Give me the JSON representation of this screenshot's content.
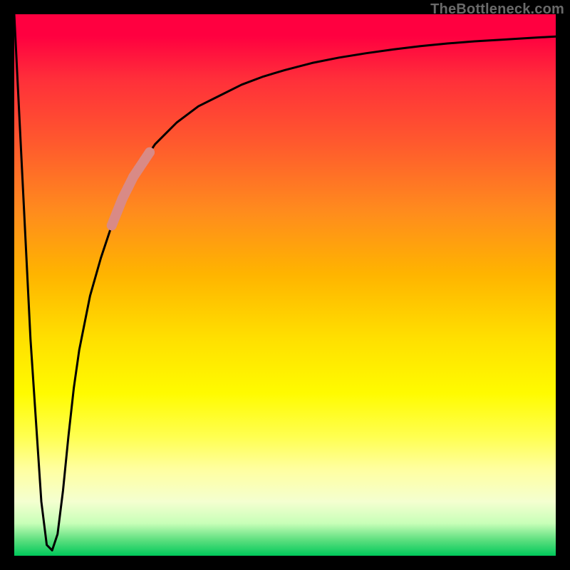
{
  "watermark": "TheBottleneck.com",
  "chart_data": {
    "type": "line",
    "title": "",
    "xlabel": "",
    "ylabel": "",
    "xlim": [
      0,
      100
    ],
    "ylim": [
      0,
      100
    ],
    "grid": false,
    "legend": false,
    "series": [
      {
        "name": "bottleneck-curve",
        "color": "#000000",
        "x": [
          0,
          1,
          3,
          5,
          6,
          7,
          8,
          9,
          10,
          11,
          12,
          14,
          16,
          18,
          20,
          22,
          24,
          26,
          28,
          30,
          34,
          38,
          42,
          46,
          50,
          55,
          60,
          65,
          70,
          75,
          80,
          85,
          90,
          95,
          100
        ],
        "values": [
          100,
          80,
          40,
          10,
          2,
          1,
          4,
          12,
          22,
          31,
          38,
          48,
          55,
          61,
          66,
          70,
          73,
          76,
          78,
          80,
          83,
          85,
          87,
          88.5,
          89.7,
          91,
          92,
          92.8,
          93.5,
          94.1,
          94.6,
          95,
          95.3,
          95.6,
          95.9
        ]
      }
    ],
    "highlight": {
      "name": "highlight-segment",
      "color": "#d98a86",
      "x": [
        18,
        19,
        20,
        21,
        22,
        23,
        24,
        25
      ],
      "values": [
        61,
        63.5,
        66,
        68,
        70,
        71.5,
        73,
        74.5
      ]
    },
    "background_gradient": {
      "top": "#ff0040",
      "mid1": "#ff8a1e",
      "mid2": "#ffe000",
      "mid3": "#ffff50",
      "bottom": "#00c85a"
    }
  }
}
